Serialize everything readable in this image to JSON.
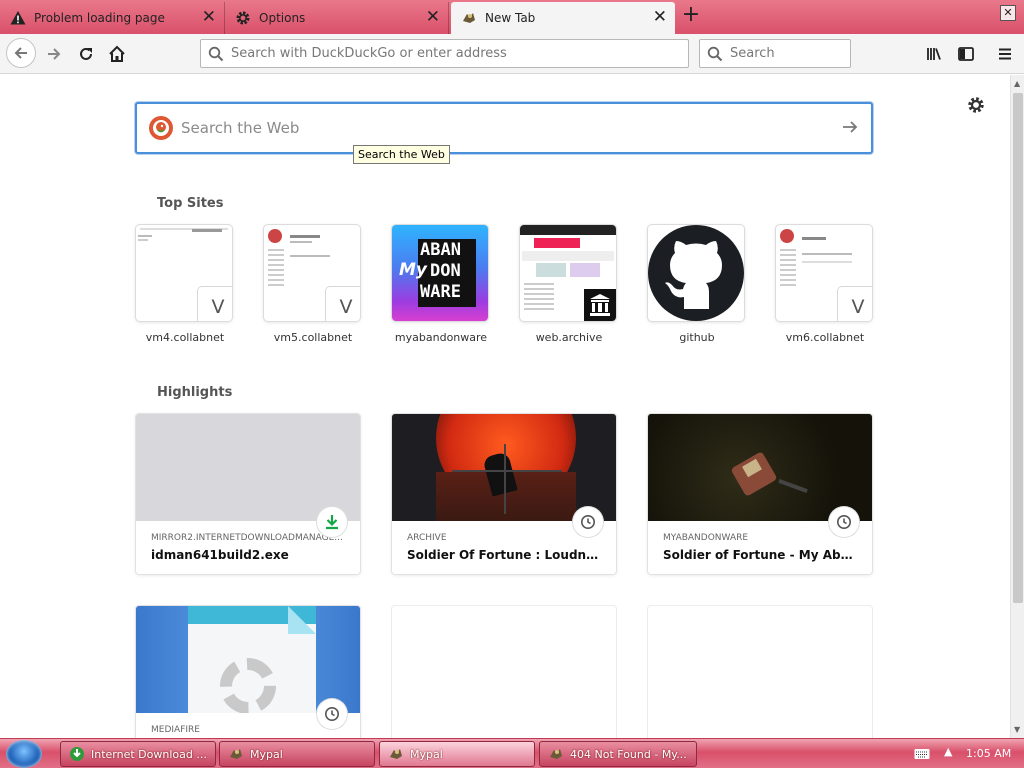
{
  "tabs": [
    {
      "title": "Problem loading page",
      "icon": "warning-icon",
      "active": false
    },
    {
      "title": "Options",
      "icon": "gear-icon",
      "active": false
    },
    {
      "title": "New Tab",
      "icon": "mypal-icon",
      "active": true
    }
  ],
  "nav": {
    "url_placeholder": "Search with DuckDuckGo or enter address",
    "search_placeholder": "Search"
  },
  "newtab": {
    "search_placeholder": "Search the Web",
    "tooltip": "Search the Web",
    "top_sites_title": "Top Sites",
    "highlights_title": "Highlights",
    "top_sites": [
      {
        "label": "vm4.collabnet",
        "badge": "V"
      },
      {
        "label": "vm5.collabnet",
        "badge": "V"
      },
      {
        "label": "myabandonware",
        "logo_text": [
          "ABAN",
          "My",
          "DON",
          "WARE"
        ]
      },
      {
        "label": "web.archive"
      },
      {
        "label": "github"
      },
      {
        "label": "vm6.collabnet",
        "badge": "V"
      }
    ],
    "highlights": [
      {
        "source": "MIRROR2.INTERNETDOWNLOADMANAGE...",
        "title": "idman641build2.exe",
        "badge": "download-icon"
      },
      {
        "source": "ARCHIVE",
        "title": "Soldier Of Fortune : Loudness : F...",
        "badge": "clock-icon"
      },
      {
        "source": "MYABANDONWARE",
        "title": "Soldier of Fortune - My Abandon...",
        "badge": "clock-icon"
      },
      {
        "source": "MEDIAFIRE",
        "title": "",
        "badge": "clock-icon"
      }
    ]
  },
  "taskbar": {
    "items": [
      {
        "label": "Internet Download ...",
        "icon": "idm-icon",
        "active": false
      },
      {
        "label": "Mypal",
        "icon": "mypal-icon",
        "active": false
      },
      {
        "label": "Mypal",
        "icon": "mypal-icon",
        "active": true
      },
      {
        "label": "404 Not Found - My...",
        "icon": "mypal-icon",
        "active": false
      }
    ],
    "clock": "1:05 AM"
  },
  "colors": {
    "tabbar": "#d9506a",
    "accent_blue": "#4a90d9",
    "download_green": "#12a84a",
    "duckduckgo": "#de5833"
  }
}
